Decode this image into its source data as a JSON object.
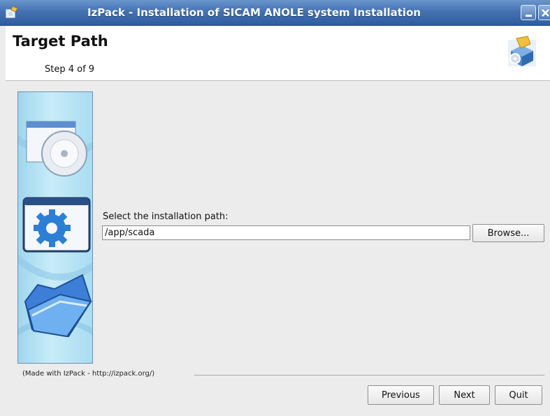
{
  "window": {
    "title": "IzPack - Installation of SICAM ANOLE system Installation",
    "app_icon": "installer-icon",
    "controls": [
      "minimize-icon",
      "close-icon"
    ]
  },
  "header": {
    "title": "Target Path",
    "step": "Step 4 of 9",
    "logo_icon": "installer-package-icon"
  },
  "side_panel": {
    "icons": [
      "cd-window-icon",
      "gear-window-icon",
      "folder-icon"
    ]
  },
  "target": {
    "label": "Select the installation path:",
    "path_value": "/app/scada",
    "browse_label": "Browse..."
  },
  "footer": {
    "made_with": "(Made with IzPack - http://izpack.org/)",
    "previous_label": "Previous",
    "next_label": "Next",
    "quit_label": "Quit"
  },
  "colors": {
    "titlebar": "#4472b3",
    "background": "#ececec",
    "header_bg": "#ffffff"
  }
}
